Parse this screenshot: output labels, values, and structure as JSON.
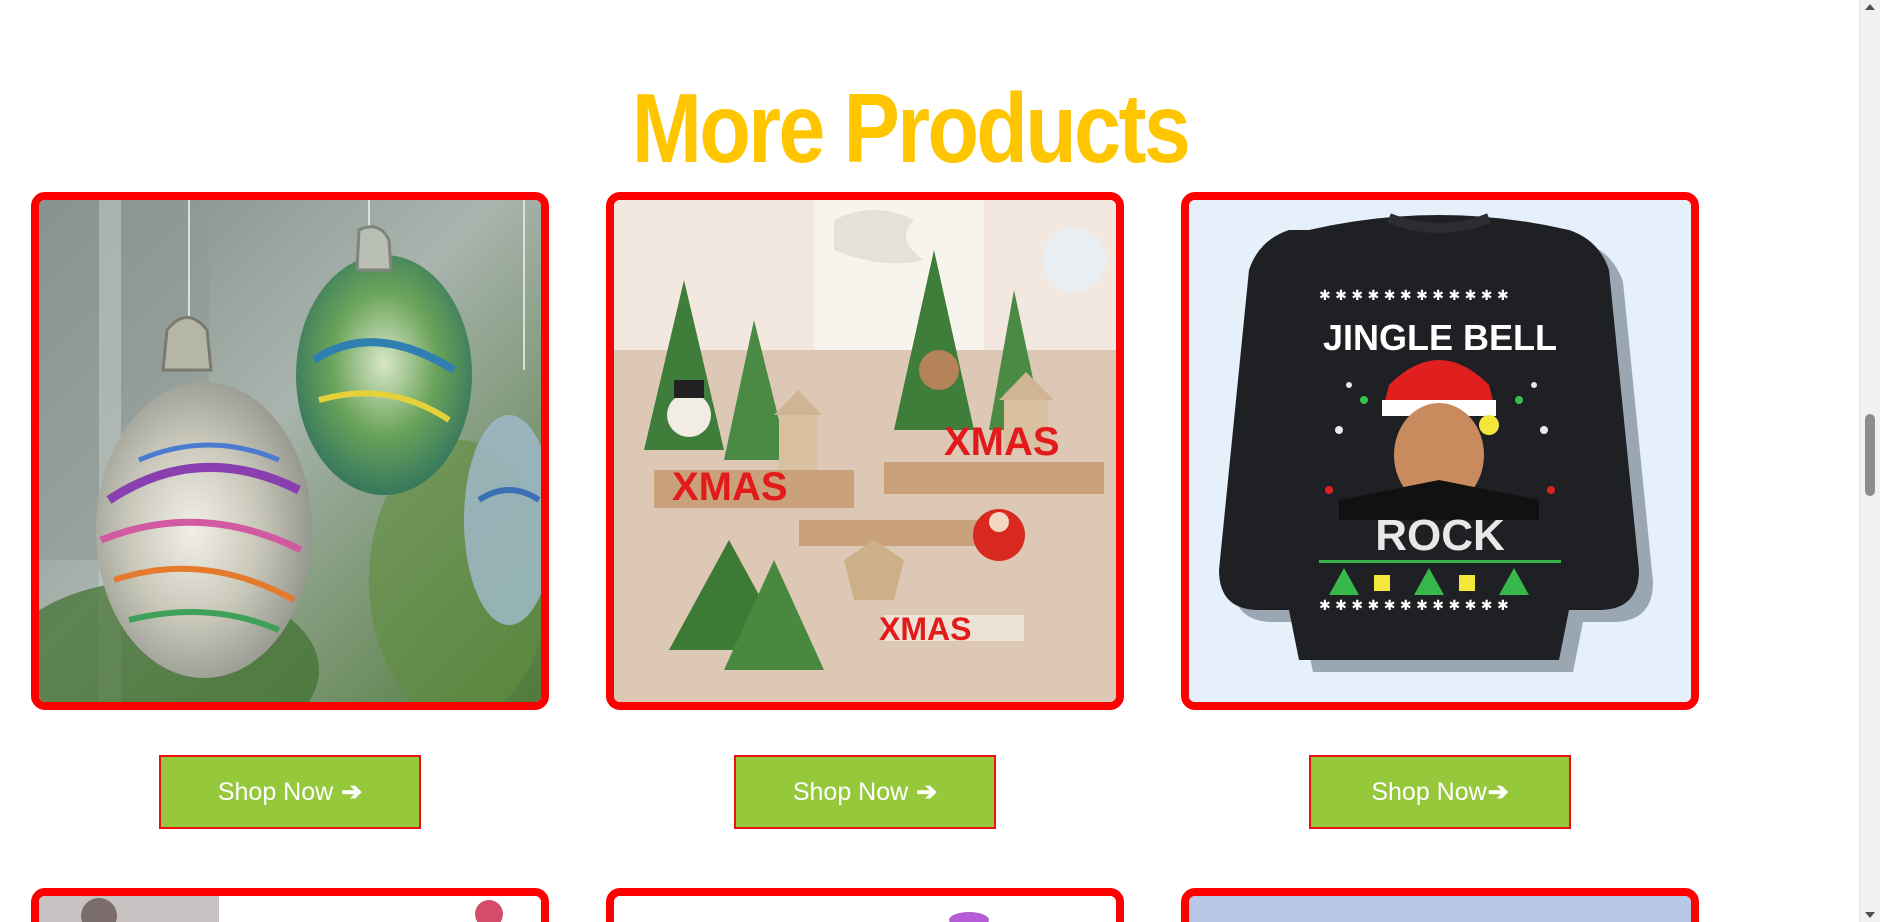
{
  "section": {
    "title": "More Products"
  },
  "products": [
    {
      "image": "glass-ornaments-photo",
      "button_label": "Shop Now",
      "button_icon": "arrow-right-icon"
    },
    {
      "image": "wooden-xmas-decor-photo",
      "button_label": "Shop Now",
      "button_icon": "arrow-right-icon"
    },
    {
      "image": "ugly-christmas-sweater-photo",
      "button_label": "Shop Now",
      "button_icon": "arrow-right-icon"
    }
  ],
  "sweater": {
    "line1": "JINGLE BELL",
    "line2": "ROCK"
  },
  "decor": {
    "sign_text": "XMAS"
  },
  "colors": {
    "title": "#ffc600",
    "card_border": "#ff0000",
    "button_bg": "#96c83c",
    "button_border": "#ee1111",
    "button_text": "#ffffff"
  }
}
